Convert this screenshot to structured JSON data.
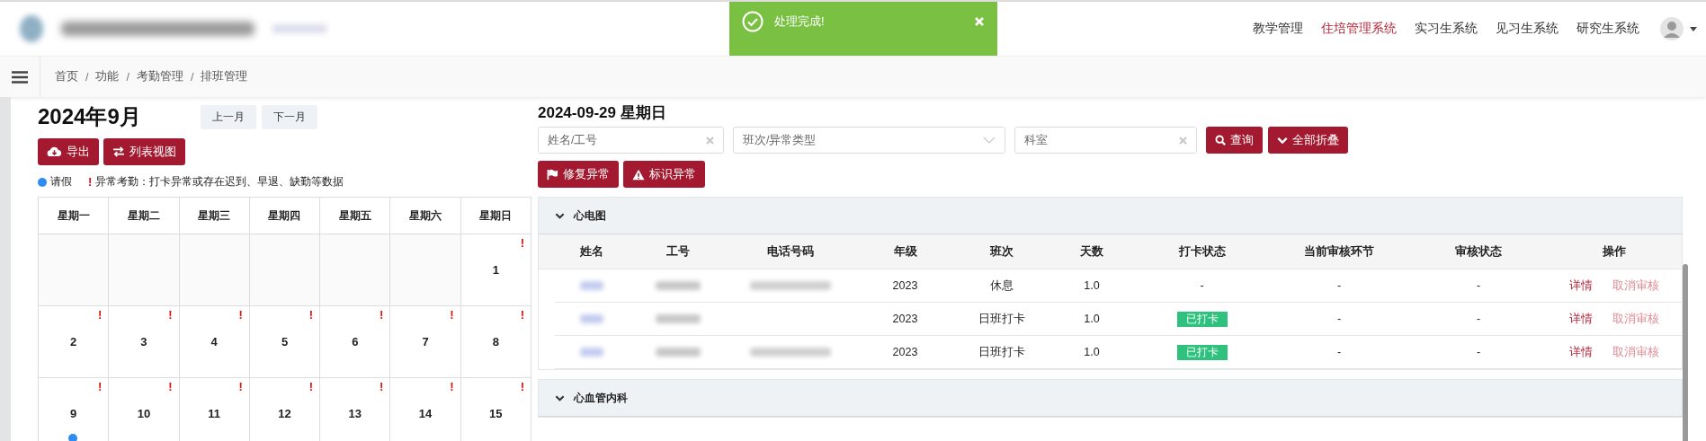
{
  "header": {
    "nav": [
      {
        "label": "教学管理",
        "selected": false
      },
      {
        "label": "住培管理系统",
        "selected": true
      },
      {
        "label": "实习生系统",
        "selected": false
      },
      {
        "label": "见习生系统",
        "selected": false
      },
      {
        "label": "研究生系统",
        "selected": false
      }
    ]
  },
  "toast": {
    "message": "处理完成!"
  },
  "breadcrumb": {
    "separator": "/",
    "items": [
      "首页",
      "功能",
      "考勤管理",
      "排班管理"
    ]
  },
  "calendar": {
    "title": "2024年9月",
    "nav_buttons": [
      "上一月",
      "下一月"
    ],
    "actions": [
      {
        "label": "导出",
        "kind": "export"
      },
      {
        "label": "列表视图",
        "kind": "swap"
      }
    ],
    "legend": {
      "leave": "请假",
      "abnormal_mark": "!",
      "abnormal": "异常考勤：打卡异常或存在迟到、早退、缺勤等数据"
    },
    "weekdays": [
      "星期一",
      "星期二",
      "星期三",
      "星期四",
      "星期五",
      "星期六",
      "星期日"
    ],
    "weeks": [
      [
        {
          "kind": "blank"
        },
        {
          "kind": "blank"
        },
        {
          "kind": "blank"
        },
        {
          "kind": "blank"
        },
        {
          "kind": "blank"
        },
        {
          "kind": "blank"
        },
        {
          "kind": "day",
          "day": "1",
          "abnormal": true,
          "leave": false
        }
      ],
      [
        {
          "kind": "day",
          "day": "2",
          "abnormal": true,
          "leave": false
        },
        {
          "kind": "day",
          "day": "3",
          "abnormal": true,
          "leave": false
        },
        {
          "kind": "day",
          "day": "4",
          "abnormal": true,
          "leave": false
        },
        {
          "kind": "day",
          "day": "5",
          "abnormal": true,
          "leave": false
        },
        {
          "kind": "day",
          "day": "6",
          "abnormal": true,
          "leave": false
        },
        {
          "kind": "day",
          "day": "7",
          "abnormal": true,
          "leave": false
        },
        {
          "kind": "day",
          "day": "8",
          "abnormal": true,
          "leave": false
        }
      ],
      [
        {
          "kind": "day",
          "day": "9",
          "abnormal": true,
          "leave": true
        },
        {
          "kind": "day",
          "day": "10",
          "abnormal": true,
          "leave": false
        },
        {
          "kind": "day",
          "day": "11",
          "abnormal": true,
          "leave": false
        },
        {
          "kind": "day",
          "day": "12",
          "abnormal": true,
          "leave": false
        },
        {
          "kind": "day",
          "day": "13",
          "abnormal": true,
          "leave": false
        },
        {
          "kind": "day",
          "day": "14",
          "abnormal": true,
          "leave": false
        },
        {
          "kind": "day",
          "day": "15",
          "abnormal": true,
          "leave": false
        }
      ]
    ]
  },
  "schedule": {
    "date": "2024-09-29 星期日",
    "filters": [
      {
        "kind": "text",
        "placeholder": "姓名/工号"
      },
      {
        "kind": "select",
        "placeholder": "班次/异常类型"
      },
      {
        "kind": "text",
        "placeholder": "科室"
      }
    ],
    "buttons": [
      {
        "label": "查询",
        "kind": "search"
      },
      {
        "label": "全部折叠",
        "kind": "collapse"
      }
    ],
    "actions": [
      {
        "label": "修复异常",
        "kind": "fix"
      },
      {
        "label": "标识异常",
        "kind": "mark"
      }
    ],
    "columns": [
      "姓名",
      "工号",
      "电话号码",
      "年级",
      "班次",
      "天数",
      "打卡状态",
      "当前审核环节",
      "审核状态",
      "操作"
    ],
    "groups": [
      {
        "name": "心电图",
        "expanded": true,
        "rows": [
          {
            "name_masked": true,
            "id_masked": true,
            "phone_masked": true,
            "grade": "2023",
            "shift": "休息",
            "days": "1.0",
            "punch": {
              "kind": "text",
              "text": "-"
            },
            "step": "-",
            "review": "-",
            "actions": [
              "详情",
              "取消审核"
            ]
          },
          {
            "name_masked": true,
            "id_masked": true,
            "phone_masked": false,
            "grade": "2023",
            "shift": "日班打卡",
            "days": "1.0",
            "punch": {
              "kind": "badge",
              "text": "已打卡"
            },
            "step": "-",
            "review": "-",
            "actions": [
              "详情",
              "取消审核"
            ]
          },
          {
            "name_masked": true,
            "id_masked": true,
            "phone_masked": true,
            "grade": "2023",
            "shift": "日班打卡",
            "days": "1.0",
            "punch": {
              "kind": "badge",
              "text": "已打卡"
            },
            "step": "-",
            "review": "-",
            "actions": [
              "详情",
              "取消审核"
            ]
          }
        ]
      },
      {
        "name": "心血管内科",
        "expanded": true
      }
    ]
  }
}
